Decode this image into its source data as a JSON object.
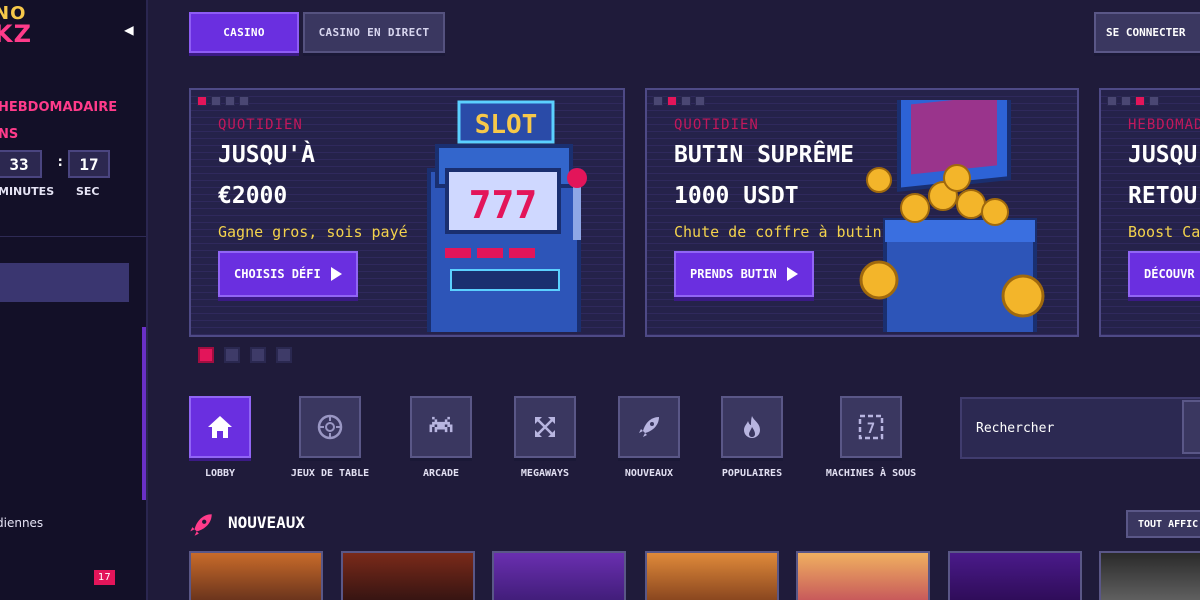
{
  "sidebar": {
    "logo_top": "NO",
    "logo_bottom": "KZ",
    "promo_title_line1": "HEBDOMADAIRE",
    "promo_title_line2": "NS",
    "timer": {
      "minutes": "33",
      "seconds": "17",
      "minutes_label": "MINUTES",
      "seconds_label": "SEC"
    },
    "item_label": "diennes",
    "badge_count": "17"
  },
  "tabs": [
    {
      "label": "CASINO",
      "active": true
    },
    {
      "label": "CASINO EN DIRECT",
      "active": false
    }
  ],
  "header": {
    "login_label": "SE CONNECTER"
  },
  "banners": [
    {
      "kicker": "QUOTIDIEN",
      "line1": "JUSQU'À",
      "line2": "€2000",
      "subtitle": "Gagne gros, sois payé",
      "button": "CHOISIS DÉFI",
      "art_label": "SLOT",
      "reels": "777"
    },
    {
      "kicker": "QUOTIDIEN",
      "line1": "BUTIN SUPRÊME",
      "line2": "1000 USDT",
      "subtitle": "Chute de coffre à butin",
      "button": "PRENDS BUTIN"
    },
    {
      "kicker": "HEBDOMADA",
      "line1": "JUSQU",
      "line2": "RETOU",
      "subtitle": "Boost Ca",
      "button": "DÉCOUVR"
    }
  ],
  "categories": [
    {
      "label": "LOBBY",
      "icon": "home-icon",
      "active": true
    },
    {
      "label": "JEUX DE TABLE",
      "icon": "chip-icon",
      "active": false
    },
    {
      "label": "ARCADE",
      "icon": "space-invader-icon",
      "active": false
    },
    {
      "label": "MEGAWAYS",
      "icon": "arrows-expand-icon",
      "active": false
    },
    {
      "label": "NOUVEAUX",
      "icon": "rocket-icon",
      "active": false
    },
    {
      "label": "POPULAIRES",
      "icon": "fire-icon",
      "active": false
    },
    {
      "label": "MACHINES À SOUS",
      "icon": "slot-machine-icon",
      "active": false
    }
  ],
  "search": {
    "placeholder": "Rechercher"
  },
  "section": {
    "title": "NOUVEAUX",
    "see_all": "TOUT AFFIC",
    "icon": "rocket-icon"
  },
  "colors": {
    "accent": "#6a2fe0",
    "pink": "#e3155a",
    "yellow": "#f3d24c",
    "bg": "#1f1b3a"
  }
}
